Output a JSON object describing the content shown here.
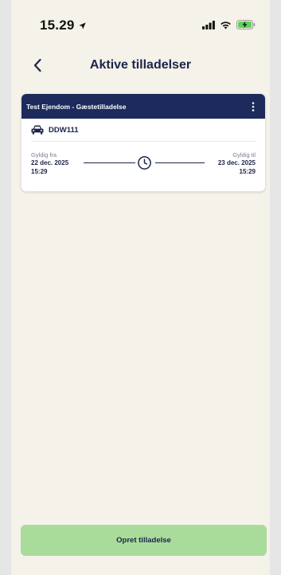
{
  "status_bar": {
    "time": "15.29",
    "icons": [
      "location-arrow-icon",
      "signal-icon",
      "wifi-icon",
      "battery-charging-icon"
    ]
  },
  "navbar": {
    "back_icon": "chevron-left-icon",
    "title": "Aktive tilladelser"
  },
  "permit_card": {
    "header_title": "Test Ejendom - Gæstetilladelse",
    "menu_icon": "kebab-menu-icon",
    "vehicle_icon": "car-icon",
    "plate": "DDW111",
    "valid_from": {
      "label": "Gyldig fra",
      "date": "22 dec. 2025",
      "time": "15:29"
    },
    "valid_to": {
      "label": "Gyldig til",
      "date": "23 dec. 2025",
      "time": "15:29"
    },
    "clock_icon": "clock-icon"
  },
  "cta": {
    "label": "Opret tilladelse"
  },
  "colors": {
    "background": "#f5f2ea",
    "navy": "#1c2a5c",
    "cta_green": "#a9dc9a",
    "muted_text": "#7a7f8e"
  }
}
